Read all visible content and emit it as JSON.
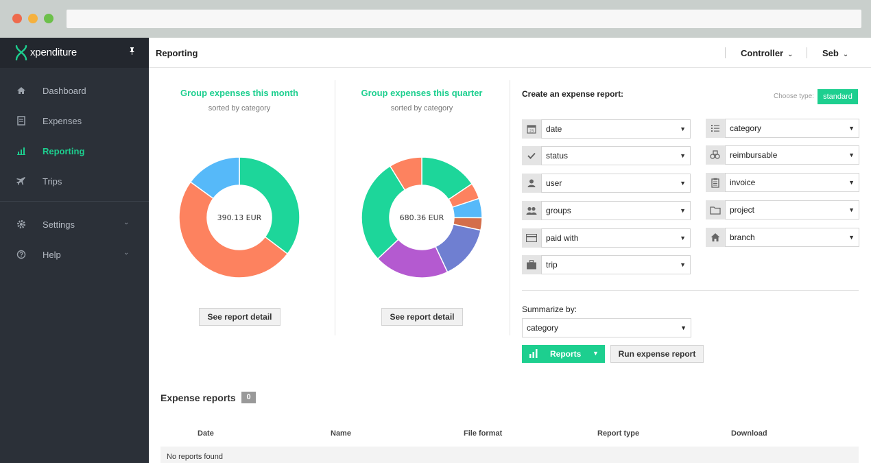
{
  "app": {
    "name": "xpenditure",
    "brand_color": "#1dcf8f"
  },
  "sidebar": {
    "items": [
      {
        "label": "Dashboard",
        "icon": "home-icon"
      },
      {
        "label": "Expenses",
        "icon": "receipt-icon"
      },
      {
        "label": "Reporting",
        "icon": "bar-chart-icon",
        "active": true
      },
      {
        "label": "Trips",
        "icon": "plane-icon"
      },
      {
        "label": "Settings",
        "icon": "gear-icon",
        "expandable": true
      },
      {
        "label": "Help",
        "icon": "help-icon",
        "expandable": true
      }
    ]
  },
  "header": {
    "title": "Reporting",
    "role_menu": "Controller",
    "user_menu": "Seb"
  },
  "charts": {
    "month": {
      "title": "Group expenses this month",
      "subtitle": "sorted by category",
      "center": "390.13 EUR",
      "button": "See report detail"
    },
    "quarter": {
      "title": "Group expenses this quarter",
      "subtitle": "sorted by category",
      "center": "680.36 EUR",
      "button": "See report detail"
    }
  },
  "chart_data": [
    {
      "type": "pie",
      "title": "Group expenses this month",
      "subtitle": "sorted by category",
      "total": "390.13 EUR",
      "slices": [
        {
          "share": 0.353,
          "color": "#1dd69a"
        },
        {
          "share": 0.497,
          "color": "#fd825f"
        },
        {
          "share": 0.15,
          "color": "#56b9f9"
        }
      ]
    },
    {
      "type": "pie",
      "title": "Group expenses this quarter",
      "subtitle": "sorted by category",
      "total": "680.36 EUR",
      "slices": [
        {
          "share": 0.156,
          "color": "#1dd69a"
        },
        {
          "share": 0.043,
          "color": "#fd825f"
        },
        {
          "share": 0.052,
          "color": "#56b9f9"
        },
        {
          "share": 0.033,
          "color": "#d46e4a"
        },
        {
          "share": 0.146,
          "color": "#6f7fd1"
        },
        {
          "share": 0.2,
          "color": "#b45ad0"
        },
        {
          "share": 0.282,
          "color": "#1dd69a"
        },
        {
          "share": 0.088,
          "color": "#fd825f"
        }
      ]
    }
  ],
  "report_form": {
    "title": "Create an expense report:",
    "choose_type_label": "Choose type:",
    "type": "standard",
    "filters_left": [
      {
        "label": "date",
        "icon": "calendar-icon"
      },
      {
        "label": "status",
        "icon": "check-icon"
      },
      {
        "label": "user",
        "icon": "user-icon"
      },
      {
        "label": "groups",
        "icon": "users-icon"
      },
      {
        "label": "paid with",
        "icon": "credit-card-icon"
      },
      {
        "label": "trip",
        "icon": "suitcase-icon"
      }
    ],
    "filters_right": [
      {
        "label": "category",
        "icon": "list-icon"
      },
      {
        "label": "reimbursable",
        "icon": "money-icon"
      },
      {
        "label": "invoice",
        "icon": "clipboard-icon"
      },
      {
        "label": "project",
        "icon": "folder-icon"
      },
      {
        "label": "branch",
        "icon": "building-icon"
      }
    ],
    "summarize_label": "Summarize by:",
    "summarize_value": "category",
    "reports_button": "Reports",
    "run_button": "Run expense report"
  },
  "expense_reports": {
    "title": "Expense reports",
    "count": "0",
    "columns": [
      "Date",
      "Name",
      "File format",
      "Report type",
      "Download"
    ],
    "empty_text": "No reports found"
  }
}
